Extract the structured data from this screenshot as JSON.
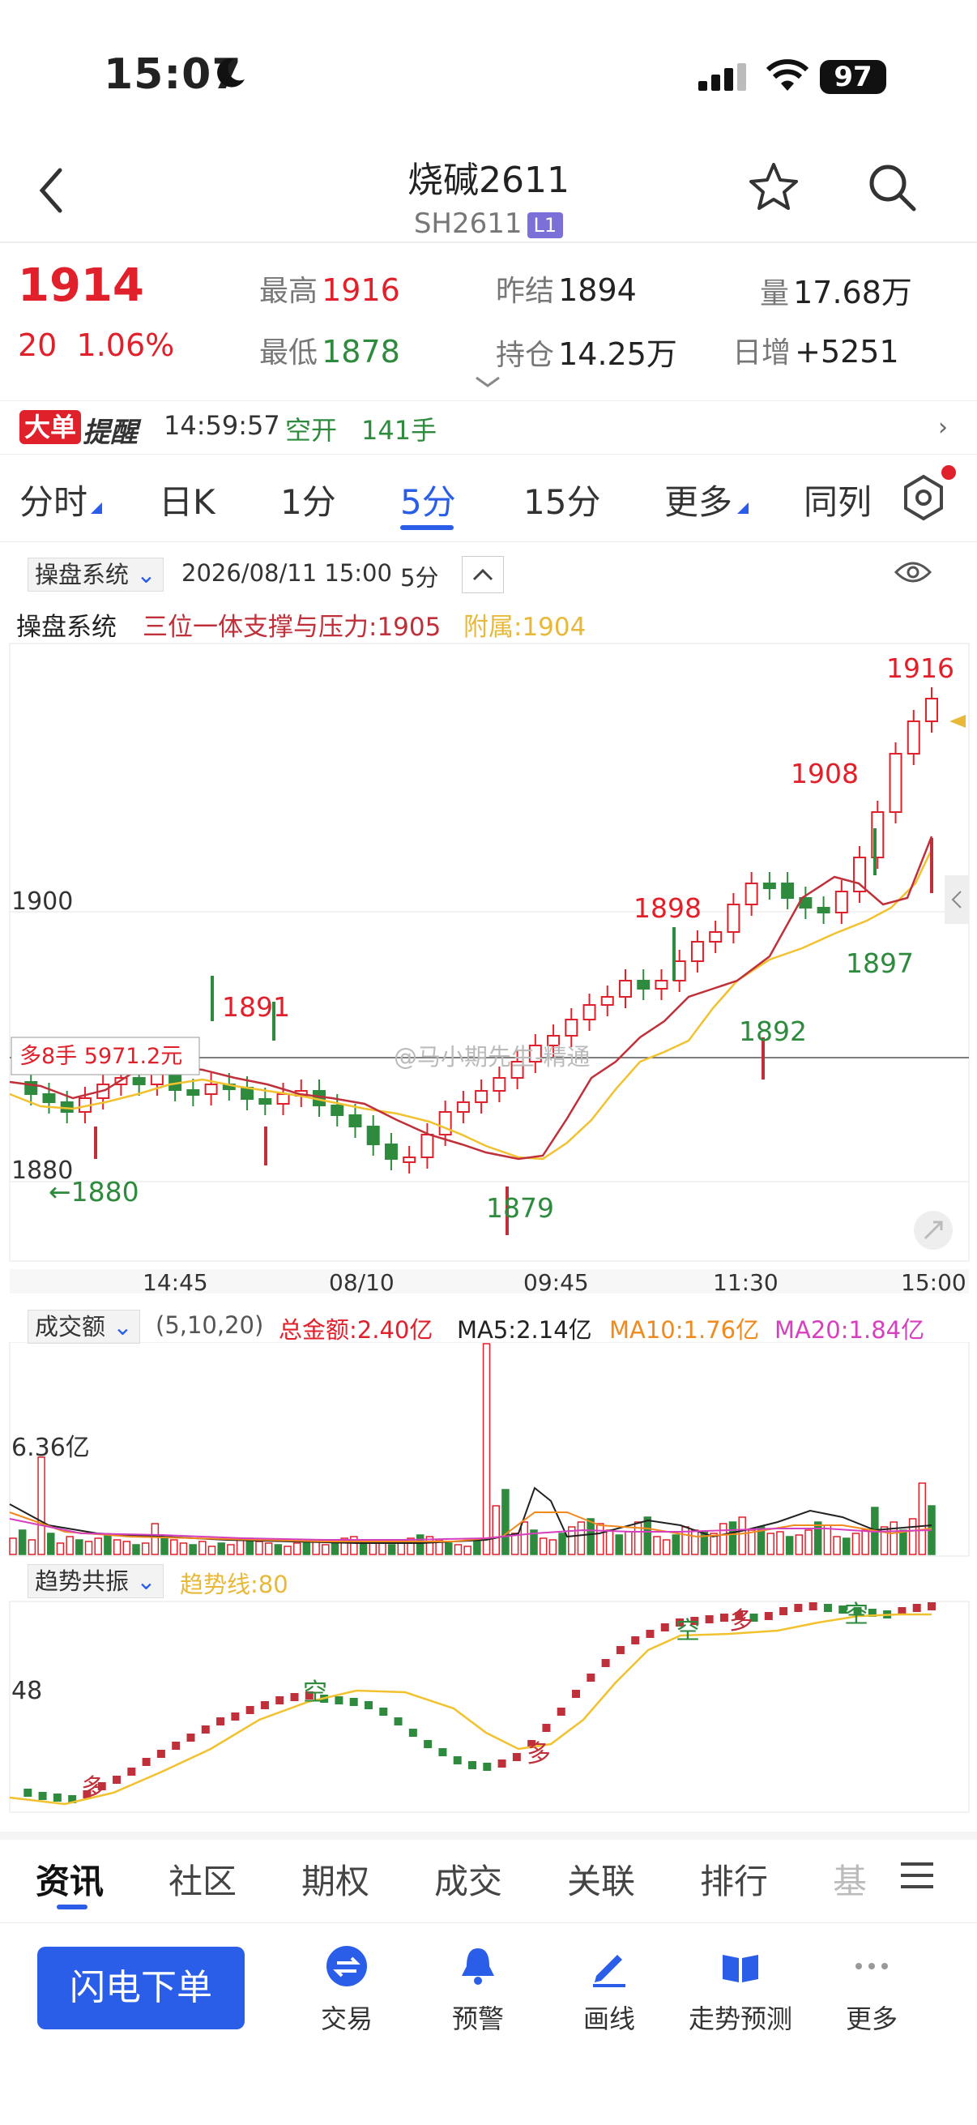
{
  "status": {
    "time": "15:07",
    "battery": "97"
  },
  "header": {
    "title": "烧碱2611",
    "code": "SH2611",
    "level": "L1"
  },
  "quote": {
    "price": "1914",
    "change": "20",
    "change_pct": "1.06%",
    "high_label": "最高",
    "high": "1916",
    "low_label": "最低",
    "low": "1878",
    "prev_settle_label": "昨结",
    "prev_settle": "1894",
    "open_int_label": "持仓",
    "open_int": "14.25万",
    "volume_label": "量",
    "volume": "17.68万",
    "daily_inc_label": "日增",
    "daily_inc": "+5251"
  },
  "alert": {
    "badge": "大单",
    "badge2": "提醒",
    "time": "14:59:57",
    "action": "空开",
    "lots": "141手"
  },
  "tabs": [
    {
      "label": "分时"
    },
    {
      "label": "日K"
    },
    {
      "label": "1分"
    },
    {
      "label": "5分"
    },
    {
      "label": "15分"
    },
    {
      "label": "更多"
    },
    {
      "label": "同列"
    }
  ],
  "chart_header": {
    "system": "操盘系统",
    "datetime": "2026/08/11 15:00",
    "period": "5分"
  },
  "indicator": {
    "name": "操盘系统",
    "main": "三位一体支撑与压力:1905",
    "sub": "附属:1904"
  },
  "candles": {
    "y_labels": [
      "1900",
      "1880"
    ],
    "x_labels": [
      "14:45",
      "08/10",
      "09:45",
      "11:30",
      "15:00"
    ],
    "annotations": [
      "1916",
      "1908",
      "1898",
      "1891",
      "1897",
      "1892",
      "1879",
      "←1880"
    ],
    "big_order": "多8手 5971.2元",
    "watermark": "@马小期先生-精通"
  },
  "volume_panel": {
    "selector": "成交额",
    "params": "(5,10,20)",
    "total": "总金额:2.40亿",
    "ma5": "MA5:2.14亿",
    "ma10": "MA10:1.76亿",
    "ma20": "MA20:1.84亿",
    "y_label": "6.36亿"
  },
  "trend_panel": {
    "selector": "趋势共振",
    "line": "趋势线:80",
    "y_label": "48",
    "marks": [
      "多",
      "空",
      "空",
      "多",
      "空",
      "多"
    ]
  },
  "bottom_tabs": [
    {
      "label": "资讯"
    },
    {
      "label": "社区"
    },
    {
      "label": "期权"
    },
    {
      "label": "成交"
    },
    {
      "label": "关联"
    },
    {
      "label": "排行"
    },
    {
      "label": "基"
    }
  ],
  "bottom_bar": {
    "order": "闪电下单",
    "items": [
      {
        "label": "交易"
      },
      {
        "label": "预警"
      },
      {
        "label": "画线"
      },
      {
        "label": "走势预测"
      },
      {
        "label": "更多"
      }
    ]
  },
  "colors": {
    "up": "#e0202a",
    "down": "#2e8b3e",
    "accent": "#2a5ee8"
  }
}
